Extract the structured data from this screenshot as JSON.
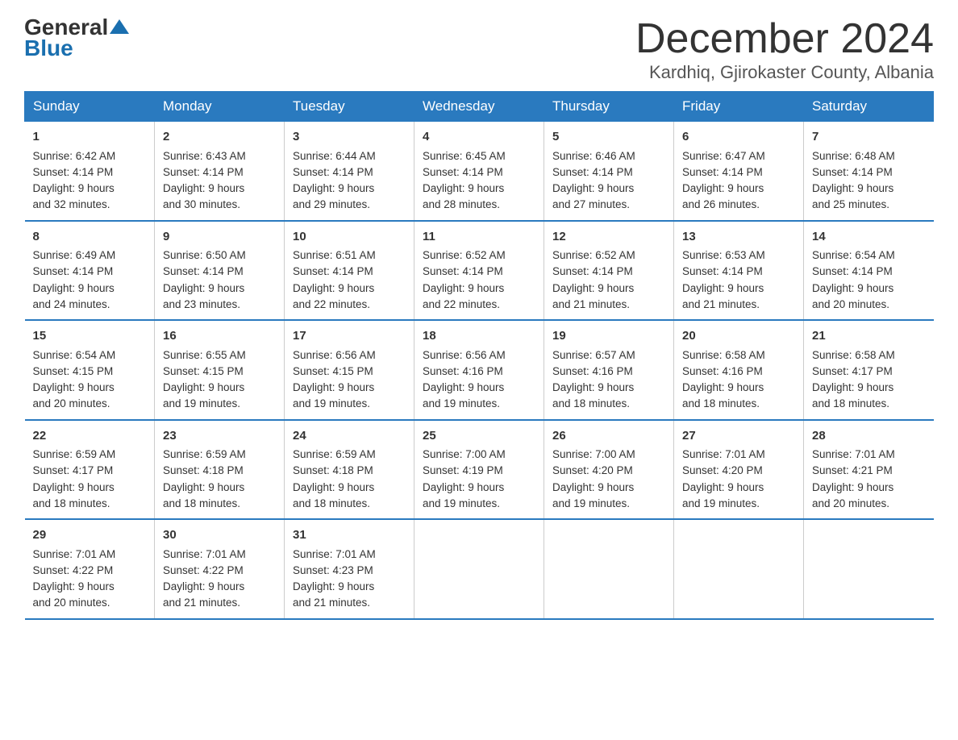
{
  "logo": {
    "line1": "General",
    "line2": "Blue"
  },
  "title": "December 2024",
  "location": "Kardhiq, Gjirokaster County, Albania",
  "days_header": [
    "Sunday",
    "Monday",
    "Tuesday",
    "Wednesday",
    "Thursday",
    "Friday",
    "Saturday"
  ],
  "weeks": [
    [
      {
        "day": "1",
        "info": "Sunrise: 6:42 AM\nSunset: 4:14 PM\nDaylight: 9 hours\nand 32 minutes."
      },
      {
        "day": "2",
        "info": "Sunrise: 6:43 AM\nSunset: 4:14 PM\nDaylight: 9 hours\nand 30 minutes."
      },
      {
        "day": "3",
        "info": "Sunrise: 6:44 AM\nSunset: 4:14 PM\nDaylight: 9 hours\nand 29 minutes."
      },
      {
        "day": "4",
        "info": "Sunrise: 6:45 AM\nSunset: 4:14 PM\nDaylight: 9 hours\nand 28 minutes."
      },
      {
        "day": "5",
        "info": "Sunrise: 6:46 AM\nSunset: 4:14 PM\nDaylight: 9 hours\nand 27 minutes."
      },
      {
        "day": "6",
        "info": "Sunrise: 6:47 AM\nSunset: 4:14 PM\nDaylight: 9 hours\nand 26 minutes."
      },
      {
        "day": "7",
        "info": "Sunrise: 6:48 AM\nSunset: 4:14 PM\nDaylight: 9 hours\nand 25 minutes."
      }
    ],
    [
      {
        "day": "8",
        "info": "Sunrise: 6:49 AM\nSunset: 4:14 PM\nDaylight: 9 hours\nand 24 minutes."
      },
      {
        "day": "9",
        "info": "Sunrise: 6:50 AM\nSunset: 4:14 PM\nDaylight: 9 hours\nand 23 minutes."
      },
      {
        "day": "10",
        "info": "Sunrise: 6:51 AM\nSunset: 4:14 PM\nDaylight: 9 hours\nand 22 minutes."
      },
      {
        "day": "11",
        "info": "Sunrise: 6:52 AM\nSunset: 4:14 PM\nDaylight: 9 hours\nand 22 minutes."
      },
      {
        "day": "12",
        "info": "Sunrise: 6:52 AM\nSunset: 4:14 PM\nDaylight: 9 hours\nand 21 minutes."
      },
      {
        "day": "13",
        "info": "Sunrise: 6:53 AM\nSunset: 4:14 PM\nDaylight: 9 hours\nand 21 minutes."
      },
      {
        "day": "14",
        "info": "Sunrise: 6:54 AM\nSunset: 4:14 PM\nDaylight: 9 hours\nand 20 minutes."
      }
    ],
    [
      {
        "day": "15",
        "info": "Sunrise: 6:54 AM\nSunset: 4:15 PM\nDaylight: 9 hours\nand 20 minutes."
      },
      {
        "day": "16",
        "info": "Sunrise: 6:55 AM\nSunset: 4:15 PM\nDaylight: 9 hours\nand 19 minutes."
      },
      {
        "day": "17",
        "info": "Sunrise: 6:56 AM\nSunset: 4:15 PM\nDaylight: 9 hours\nand 19 minutes."
      },
      {
        "day": "18",
        "info": "Sunrise: 6:56 AM\nSunset: 4:16 PM\nDaylight: 9 hours\nand 19 minutes."
      },
      {
        "day": "19",
        "info": "Sunrise: 6:57 AM\nSunset: 4:16 PM\nDaylight: 9 hours\nand 18 minutes."
      },
      {
        "day": "20",
        "info": "Sunrise: 6:58 AM\nSunset: 4:16 PM\nDaylight: 9 hours\nand 18 minutes."
      },
      {
        "day": "21",
        "info": "Sunrise: 6:58 AM\nSunset: 4:17 PM\nDaylight: 9 hours\nand 18 minutes."
      }
    ],
    [
      {
        "day": "22",
        "info": "Sunrise: 6:59 AM\nSunset: 4:17 PM\nDaylight: 9 hours\nand 18 minutes."
      },
      {
        "day": "23",
        "info": "Sunrise: 6:59 AM\nSunset: 4:18 PM\nDaylight: 9 hours\nand 18 minutes."
      },
      {
        "day": "24",
        "info": "Sunrise: 6:59 AM\nSunset: 4:18 PM\nDaylight: 9 hours\nand 18 minutes."
      },
      {
        "day": "25",
        "info": "Sunrise: 7:00 AM\nSunset: 4:19 PM\nDaylight: 9 hours\nand 19 minutes."
      },
      {
        "day": "26",
        "info": "Sunrise: 7:00 AM\nSunset: 4:20 PM\nDaylight: 9 hours\nand 19 minutes."
      },
      {
        "day": "27",
        "info": "Sunrise: 7:01 AM\nSunset: 4:20 PM\nDaylight: 9 hours\nand 19 minutes."
      },
      {
        "day": "28",
        "info": "Sunrise: 7:01 AM\nSunset: 4:21 PM\nDaylight: 9 hours\nand 20 minutes."
      }
    ],
    [
      {
        "day": "29",
        "info": "Sunrise: 7:01 AM\nSunset: 4:22 PM\nDaylight: 9 hours\nand 20 minutes."
      },
      {
        "day": "30",
        "info": "Sunrise: 7:01 AM\nSunset: 4:22 PM\nDaylight: 9 hours\nand 21 minutes."
      },
      {
        "day": "31",
        "info": "Sunrise: 7:01 AM\nSunset: 4:23 PM\nDaylight: 9 hours\nand 21 minutes."
      },
      {
        "day": "",
        "info": ""
      },
      {
        "day": "",
        "info": ""
      },
      {
        "day": "",
        "info": ""
      },
      {
        "day": "",
        "info": ""
      }
    ]
  ]
}
